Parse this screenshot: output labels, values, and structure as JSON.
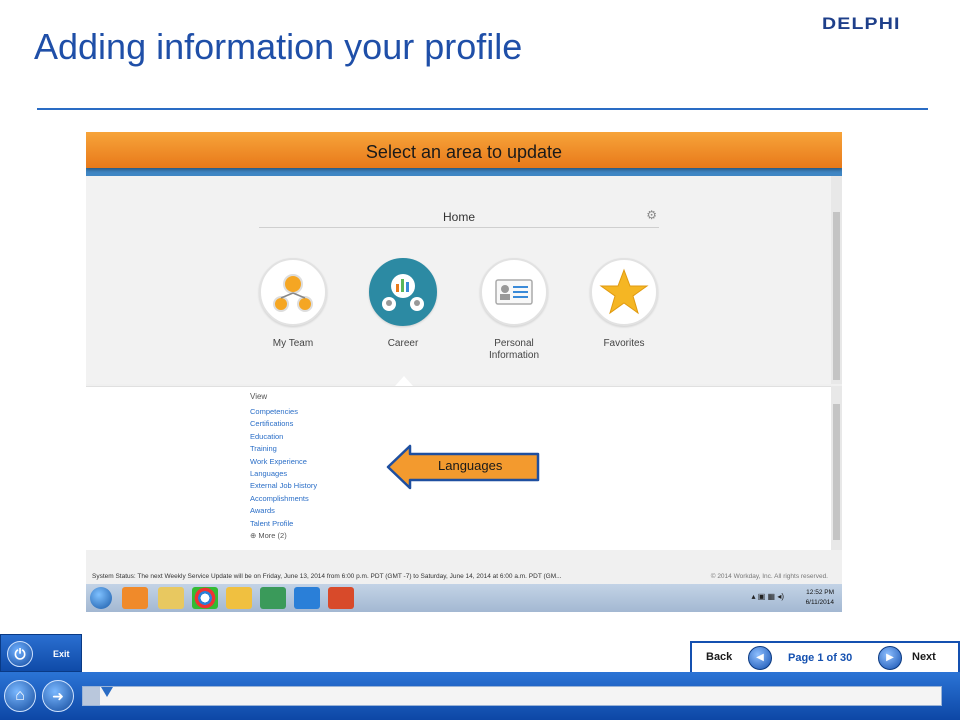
{
  "slide": {
    "title": "Adding information your profile",
    "logo_text": "DELPHI"
  },
  "banner": {
    "text": "Select an area to update"
  },
  "workday": {
    "home_label": "Home",
    "worklets": [
      {
        "label": "My Team",
        "icon": "team-icon"
      },
      {
        "label": "Career",
        "icon": "career-icon"
      },
      {
        "label": "Personal Information",
        "icon": "id-card-icon"
      },
      {
        "label": "Favorites",
        "icon": "star-icon"
      }
    ],
    "view_header": "View",
    "view_links": [
      "Competencies",
      "Certifications",
      "Education",
      "Training",
      "Work Experience",
      "Languages",
      "External Job History",
      "Accomplishments",
      "Awards",
      "Talent Profile"
    ],
    "more_label": "More (2)",
    "status_left": "System Status: The next Weekly Service Update will be on Friday, June 13, 2014 from 6:00 p.m. PDT (GMT -7) to Saturday, June 14, 2014 at 6:00 a.m. PDT (GM...",
    "status_right": "© 2014 Workday, Inc. All rights reserved."
  },
  "callout": {
    "text": "Languages"
  },
  "taskbar": {
    "time": "12:52 PM",
    "date": "6/11/2014"
  },
  "nav": {
    "exit_label": "Exit",
    "back_label": "Back",
    "page_label": "Page 1 of 30",
    "next_label": "Next",
    "progress": 0.02
  },
  "colors": {
    "title_blue": "#1f4fa8",
    "banner_orange": "#f39a2e",
    "nav_blue": "#1450b0",
    "career_teal": "#2c8aa3"
  }
}
